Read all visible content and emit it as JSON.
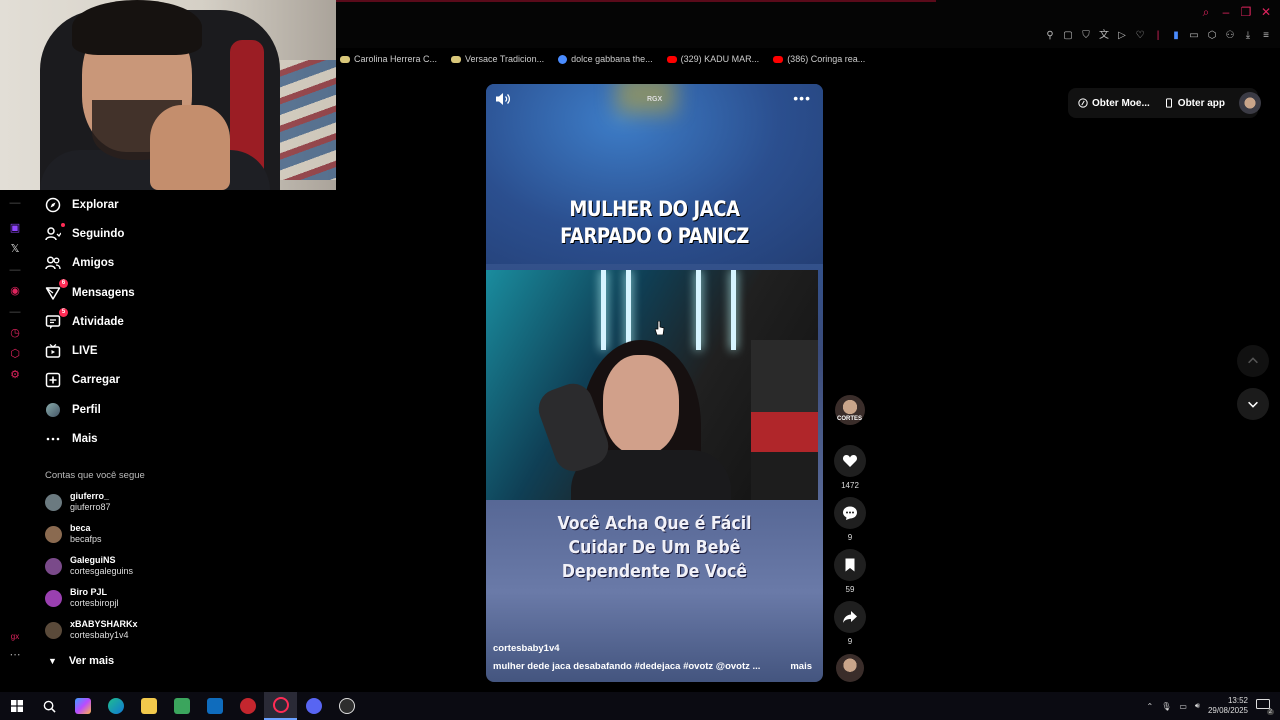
{
  "bookmarks": [
    {
      "label": "Carolina Herrera C...",
      "icon": "bookmark-icon",
      "color": "#d9c77a"
    },
    {
      "label": "Versace Tradicion...",
      "icon": "bookmark-icon",
      "color": "#d9c77a"
    },
    {
      "label": "dolce gabbana the...",
      "icon": "google-icon",
      "color": "#4a8cff"
    },
    {
      "label": "(329) KADU MAR...",
      "icon": "youtube-icon",
      "color": "#ff0000"
    },
    {
      "label": "(386) Coringa rea...",
      "icon": "youtube-icon",
      "color": "#ff0000"
    }
  ],
  "header": {
    "get_coins": "Obter Moe...",
    "get_app": "Obter app"
  },
  "nav": [
    {
      "label": "Explorar",
      "icon": "compass-icon"
    },
    {
      "label": "Seguindo",
      "icon": "following-icon",
      "dot": true
    },
    {
      "label": "Amigos",
      "icon": "friends-icon"
    },
    {
      "label": "Mensagens",
      "icon": "messages-icon",
      "badge": "6"
    },
    {
      "label": "Atividade",
      "icon": "activity-icon",
      "badge": "5"
    },
    {
      "label": "LIVE",
      "icon": "live-icon"
    },
    {
      "label": "Carregar",
      "icon": "upload-icon"
    },
    {
      "label": "Perfil",
      "icon": "avatar-icon"
    },
    {
      "label": "Mais",
      "icon": "more-icon"
    }
  ],
  "following": {
    "heading": "Contas que você segue",
    "accounts": [
      {
        "name": "giuferro_",
        "handle": "giuferro87",
        "color": "#6b7a80"
      },
      {
        "name": "beca",
        "handle": "becafps",
        "color": "#8a6a50"
      },
      {
        "name": "GaleguiNS",
        "handle": "cortesgaleguins",
        "color": "#7a4a8a"
      },
      {
        "name": "Biro PJL",
        "handle": "cortesbiropjl",
        "color": "#9a40b0"
      },
      {
        "name": "xBABYSHARKx",
        "handle": "cortesbaby1v4",
        "color": "#5a4a3a"
      }
    ],
    "more_label": "Ver mais"
  },
  "video": {
    "logo": "RGX",
    "headline_line1": "MULHER DO JACA",
    "headline_line2": "FARPADO O PANICZ",
    "quote_line1": "Você Acha Que é Fácil",
    "quote_line2": "Cuidar De Um Bebê",
    "quote_line3": "Dependente De Você",
    "author": "cortesbaby1v4",
    "description": "mulher dede jaca desabafando #dedejaca  #ovotz  @ovotz  ...",
    "more_label": "mais",
    "creator_tag": "CORTES"
  },
  "actions": {
    "likes": "1472",
    "comments": "9",
    "saves": "59",
    "shares": "9"
  },
  "taskbar": {
    "time": "13:52",
    "date": "29/08/2025",
    "notifications": "2"
  },
  "colors": {
    "accent": "#fe2c55",
    "rail": "#e0245e"
  }
}
